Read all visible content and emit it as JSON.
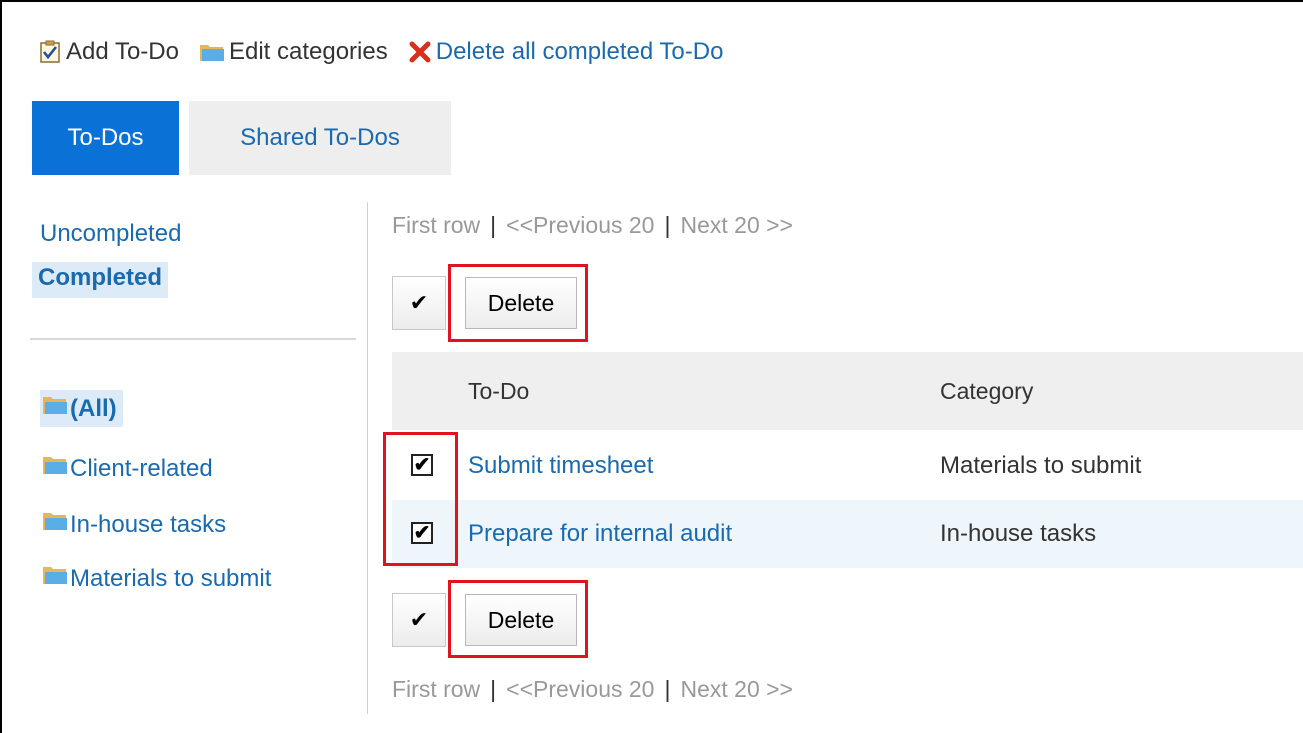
{
  "toolbar": {
    "add_todo": "Add To-Do",
    "edit_categories": "Edit categories",
    "delete_all_completed": "Delete all completed To-Do"
  },
  "tabs": [
    {
      "label": "To-Dos",
      "active": true
    },
    {
      "label": "Shared To-Dos",
      "active": false
    }
  ],
  "sidebar": {
    "status_items": [
      {
        "label": "Uncompleted",
        "selected": false
      },
      {
        "label": "Completed",
        "selected": true
      }
    ],
    "categories": [
      {
        "label": "(All)",
        "selected": true
      },
      {
        "label": "Client-related",
        "selected": false
      },
      {
        "label": "In-house tasks",
        "selected": false
      },
      {
        "label": "Materials to submit",
        "selected": false
      }
    ]
  },
  "pagination": {
    "first": "First row",
    "separator": "|",
    "previous": "<<Previous 20",
    "next": "Next 20 >>"
  },
  "actions": {
    "check_all_glyph": "✔",
    "delete_label": "Delete"
  },
  "table": {
    "columns": [
      "To-Do",
      "Category"
    ],
    "rows": [
      {
        "checked": true,
        "todo": "Submit timesheet",
        "category": "Materials to submit"
      },
      {
        "checked": true,
        "todo": "Prepare for internal audit",
        "category": "In-house tasks"
      }
    ],
    "checkbox_glyph": "✔"
  },
  "colors": {
    "link": "#1a6ab0",
    "active_tab": "#0a72d6",
    "highlight": "#e0141e",
    "selected_bg": "#dcebf7"
  },
  "icons": {
    "add_todo": "checkbox-clipboard-icon",
    "edit_categories": "folder-icon",
    "delete_all": "red-x-icon"
  }
}
